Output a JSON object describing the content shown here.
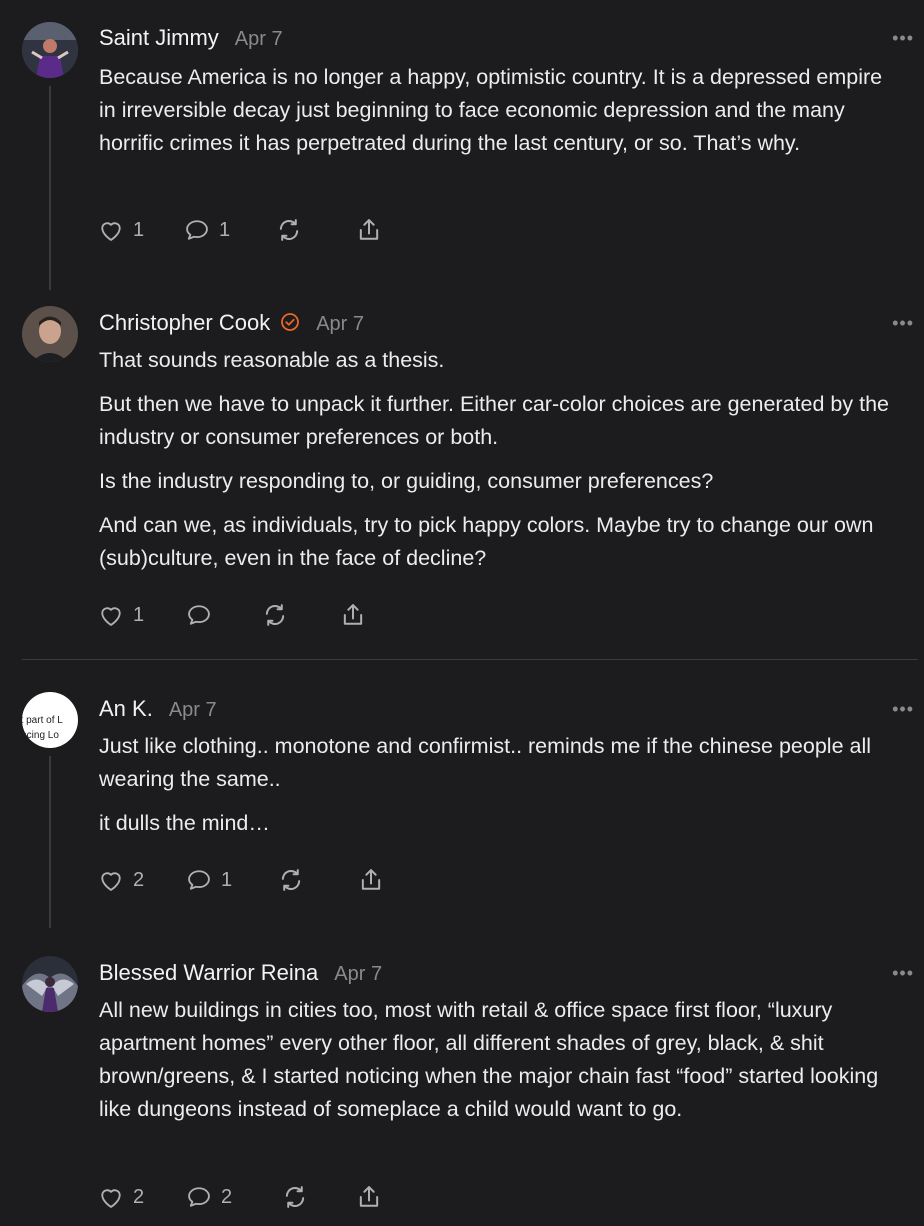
{
  "comments": [
    {
      "author": "Saint Jimmy",
      "date": "Apr 7",
      "more": "•••",
      "paragraphs": [
        "Because America is no longer a happy, optimistic country. It is a depressed empire in irreversible decay just beginning to face economic depression and the many horrific crimes it has perpetrated during the last century, or so. That’s why."
      ],
      "likes": "1",
      "replies": "1"
    },
    {
      "author": "Christopher Cook",
      "date": "Apr 7",
      "more": "•••",
      "verified": true,
      "paragraphs": [
        "That sounds reasonable as a thesis.",
        "But then we have to unpack it further. Either car-color choices are generated by the industry or consumer preferences or both.",
        "Is the industry responding to, or guiding, consumer preferences?",
        "And can we, as individuals, try to pick happy colors. Maybe try to change our own (sub)culture, even in the face of decline?"
      ],
      "likes": "1",
      "replies": ""
    },
    {
      "author": "An K.",
      "date": "Apr 7",
      "more": "•••",
      "avatar_text": [
        "est part of L",
        "riencing Lo"
      ],
      "paragraphs": [
        "Just like clothing.. monotone and confirmist.. reminds me if the chinese people all wearing the same..",
        "it dulls the mind…"
      ],
      "likes": "2",
      "replies": "1"
    },
    {
      "author": "Blessed Warrior Reina",
      "date": "Apr 7",
      "more": "•••",
      "paragraphs": [
        "All new buildings in cities too, most with retail & office space first floor, “luxury apartment homes” every other floor, all different shades of grey, black, & shit brown/greens, & I started noticing when the major chain fast “food” started looking like dungeons instead of someplace a child would want to go."
      ],
      "likes": "2",
      "replies": "2"
    }
  ],
  "colors": {
    "background": "#1c1c1e",
    "text": "#ececec",
    "muted": "#8a8a8e",
    "verified": "#e8672a"
  }
}
